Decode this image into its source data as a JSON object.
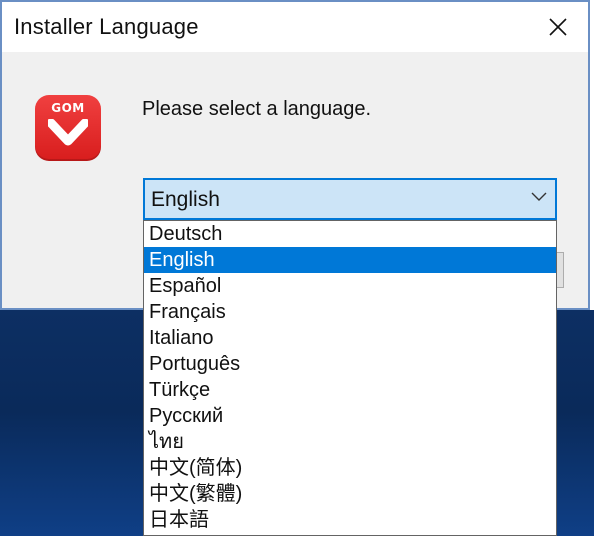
{
  "window": {
    "title": "Installer Language"
  },
  "icon": {
    "name": "gom-logo-icon",
    "text": "GOM",
    "color": "#e32626"
  },
  "prompt": "Please select a language.",
  "combo": {
    "selected": "English"
  },
  "languages": [
    "Deutsch",
    "English",
    "Español",
    "Français",
    "Italiano",
    "Português",
    "Türkçe",
    "Русский",
    "ไทย",
    "中文(简体)",
    "中文(繁體)",
    "日本語"
  ],
  "selected_index": 1,
  "colors": {
    "accent": "#0078d7",
    "combo_bg": "#cce4f7"
  }
}
